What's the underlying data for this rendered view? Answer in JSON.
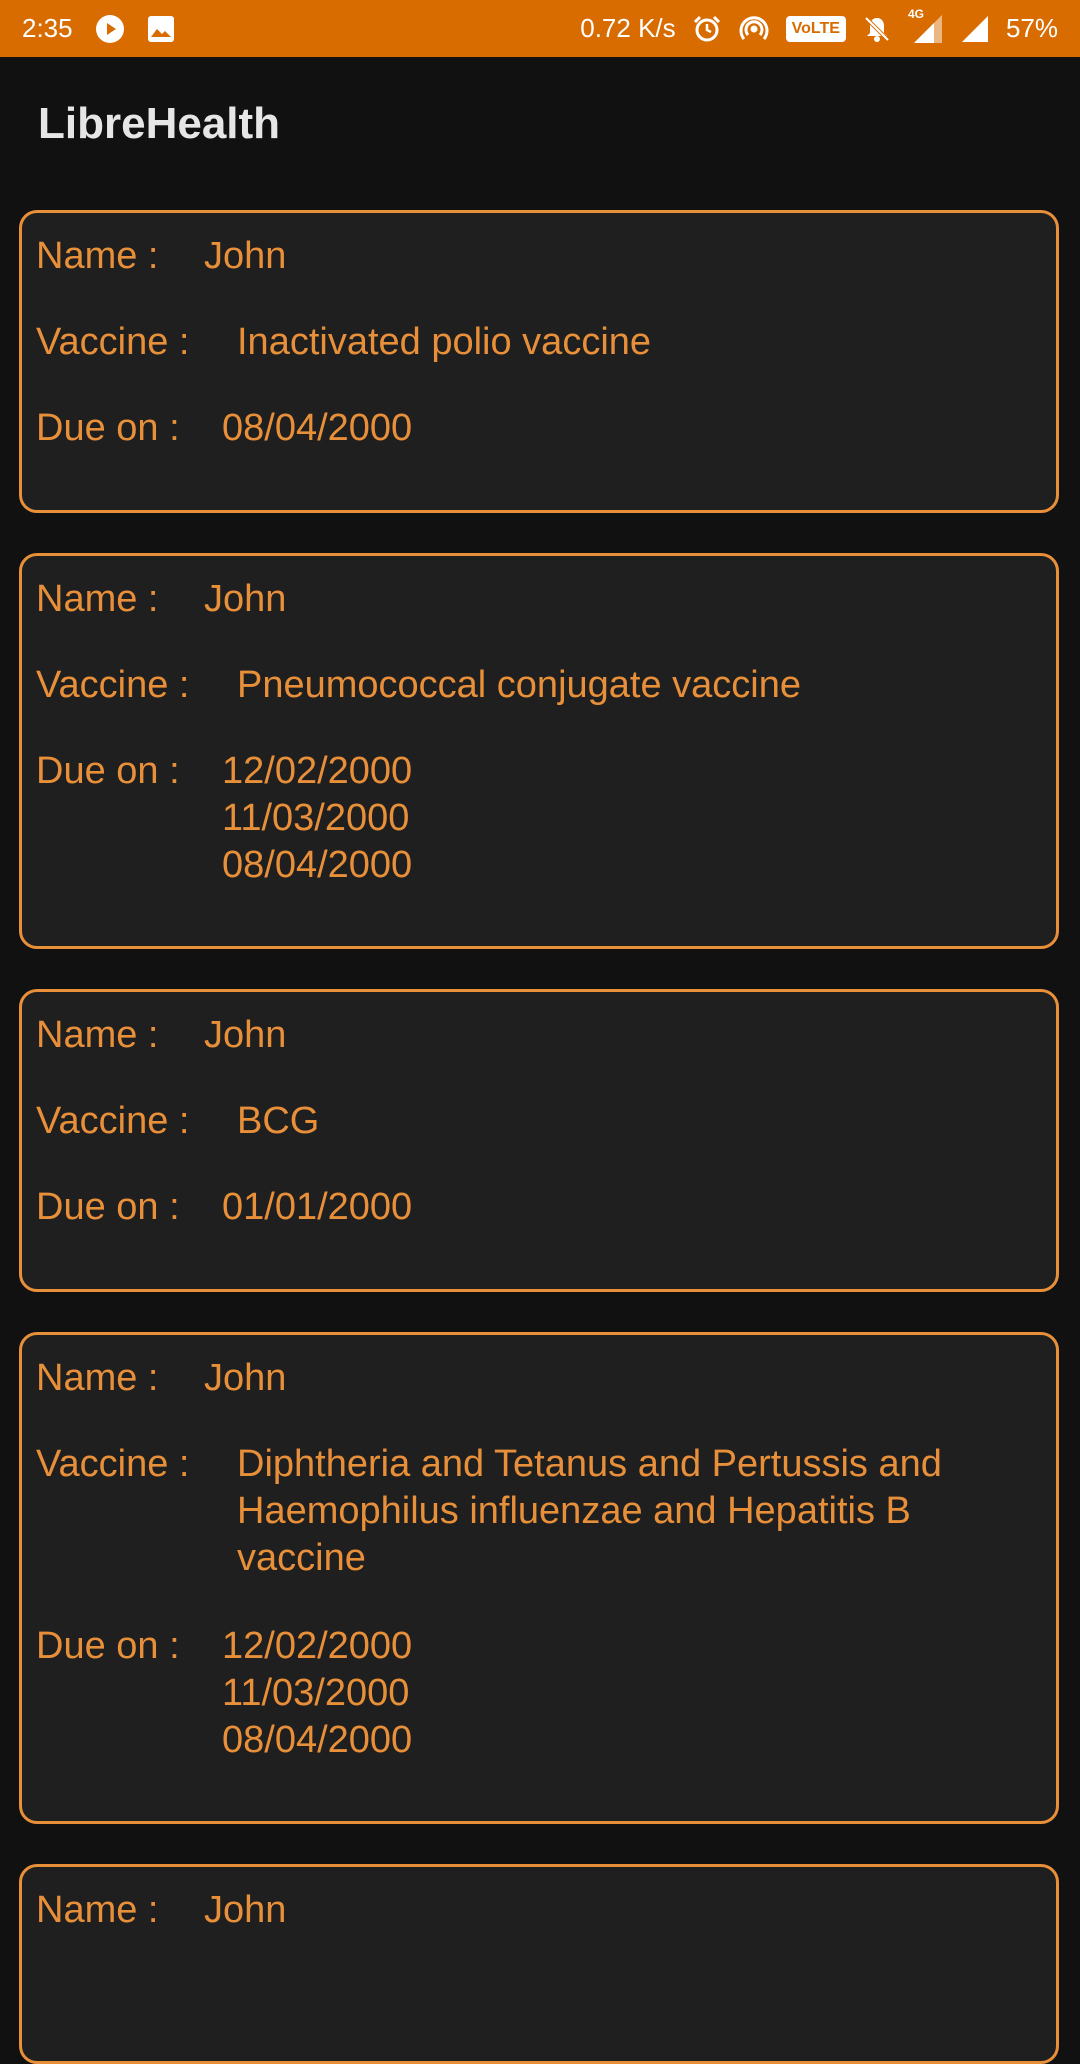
{
  "status_bar": {
    "time": "2:35",
    "speed": "0.72 K/s",
    "volte": "VoLTE",
    "network": "4G",
    "battery": "57%",
    "icons": [
      "play-icon",
      "image-icon",
      "alarm-icon",
      "hotspot-icon",
      "volte-icon",
      "mute-icon",
      "signal-4g-icon",
      "signal-icon",
      "battery-text"
    ]
  },
  "app": {
    "title": "LibreHealth"
  },
  "labels": {
    "name": "Name :",
    "vaccine": "Vaccine :",
    "due": "Due on :"
  },
  "cards": [
    {
      "name": "John",
      "vaccine": "Inactivated polio vaccine",
      "due": [
        "08/04/2000"
      ]
    },
    {
      "name": "John",
      "vaccine": "Pneumococcal conjugate vaccine",
      "due": [
        "12/02/2000",
        "11/03/2000",
        "08/04/2000"
      ]
    },
    {
      "name": "John",
      "vaccine": "BCG",
      "due": [
        "01/01/2000"
      ]
    },
    {
      "name": "John",
      "vaccine": "Diphtheria and Tetanus and Pertussis and Haemophilus influenzae and Hepatitis B vaccine",
      "due": [
        "12/02/2000",
        "11/03/2000",
        "08/04/2000"
      ]
    },
    {
      "name": "John"
    }
  ],
  "colors": {
    "accent": "#E88F3A",
    "status_bar": "#D96C00",
    "card_bg": "#1f1f1f",
    "page_bg": "#111111"
  }
}
